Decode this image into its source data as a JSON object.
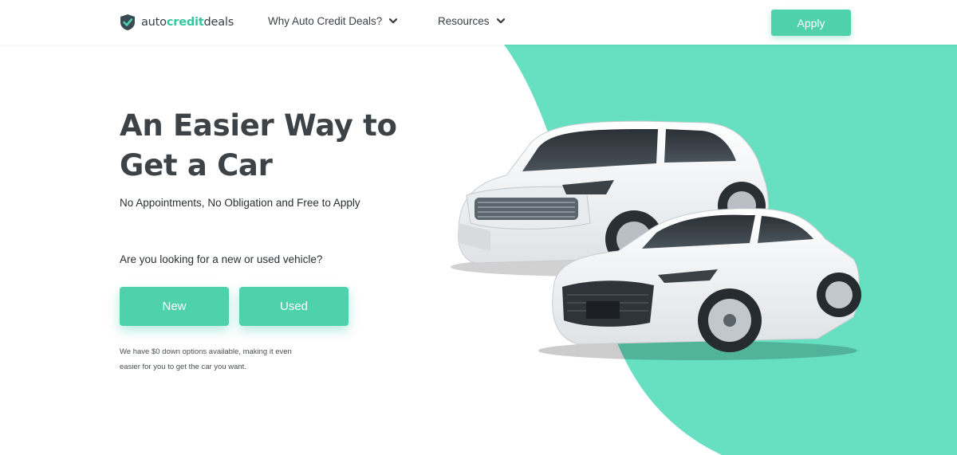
{
  "brand": {
    "part1": "auto",
    "part2": "credit",
    "part3": "deals",
    "icon": "shield-check-icon"
  },
  "nav": {
    "items": [
      {
        "label": "Why Auto Credit Deals?",
        "icon": "chevron-down-icon"
      },
      {
        "label": "Resources",
        "icon": "chevron-down-icon"
      }
    ],
    "apply_label": "Apply"
  },
  "hero": {
    "headline_line1": "An Easier Way to",
    "headline_line2": "Get a Car",
    "subheadline": "No Appointments, No Obligation and Free to Apply",
    "question": "Are you looking for a new or used vehicle?",
    "new_label": "New",
    "used_label": "Used",
    "note_line1": "We have $0 down options available, making it even",
    "note_line2": "easier for you to get the car you want.",
    "image": "suv-and-coupe-image"
  },
  "colors": {
    "accent": "#4fd1ab",
    "accent_light": "#66e0c1",
    "text_dark": "#3d4246"
  }
}
